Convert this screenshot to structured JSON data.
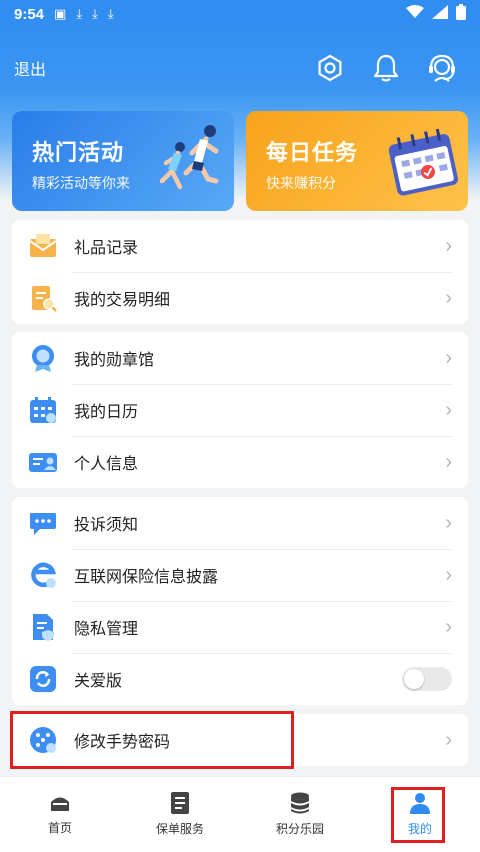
{
  "status_bar": {
    "time": "9:54"
  },
  "header": {
    "logout_label": "退出"
  },
  "banners": [
    {
      "title": "热门活动",
      "subtitle": "精彩活动等你来"
    },
    {
      "title": "每日任务",
      "subtitle": "快来赚积分"
    }
  ],
  "menu_group_1": [
    {
      "label": "礼品记录"
    },
    {
      "label": "我的交易明细"
    }
  ],
  "menu_group_2": [
    {
      "label": "我的勋章馆"
    },
    {
      "label": "我的日历"
    },
    {
      "label": "个人信息"
    }
  ],
  "menu_group_3": [
    {
      "label": "投诉须知"
    },
    {
      "label": "互联网保险信息披露"
    },
    {
      "label": "隐私管理"
    },
    {
      "label": "关爱版",
      "toggle_on": false
    }
  ],
  "menu_group_4": [
    {
      "label": "修改手势密码"
    }
  ],
  "tabs": [
    {
      "label": "首页",
      "active": false
    },
    {
      "label": "保单服务",
      "active": false
    },
    {
      "label": "积分乐园",
      "active": false
    },
    {
      "label": "我的",
      "active": true
    }
  ],
  "colors": {
    "primary": "#2f8cf0",
    "highlight": "#e02020",
    "orange": "#f7a21b"
  }
}
